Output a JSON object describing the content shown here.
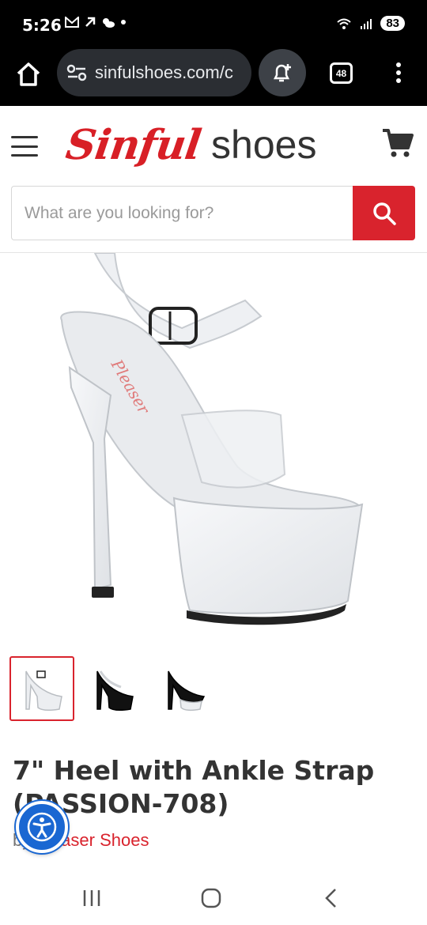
{
  "status_bar": {
    "time": "5:26",
    "battery": "83"
  },
  "browser": {
    "url": "sinfulshoes.com/c",
    "tab_count": "48"
  },
  "site": {
    "logo_script": "Sinful",
    "logo_word": "shoes",
    "search_placeholder": "What are you looking for?",
    "brand_color": "#d9232d"
  },
  "product": {
    "title": "7\" Heel with Ankle Strap (PASSION-708)",
    "by_label": "by",
    "brand": "Pleaser Shoes",
    "thumbnails": [
      {
        "variant": "clear"
      },
      {
        "variant": "black"
      },
      {
        "variant": "clear-black"
      }
    ]
  },
  "icons": [
    "home-icon",
    "site-settings-icon",
    "add-notification-icon",
    "tabs-icon",
    "more-vert-icon",
    "menu-icon",
    "cart-icon",
    "search-icon",
    "accessibility-icon",
    "recent-apps-icon",
    "home-nav-icon",
    "back-icon"
  ]
}
